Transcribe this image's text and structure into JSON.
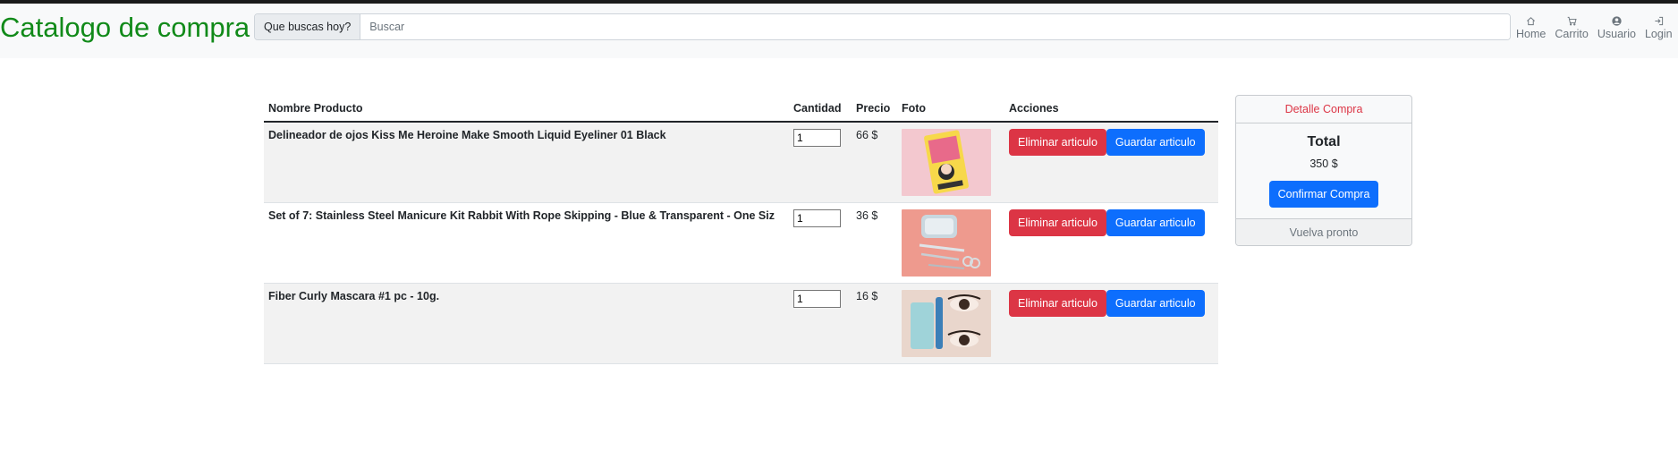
{
  "brand": "Catalogo de compra",
  "search": {
    "label": "Que buscas hoy?",
    "placeholder": "Buscar",
    "value": ""
  },
  "nav": [
    {
      "label": "Home",
      "icon": "home-icon"
    },
    {
      "label": "Carrito",
      "icon": "cart-icon"
    },
    {
      "label": "Usuario",
      "icon": "user-icon"
    },
    {
      "label": "Login",
      "icon": "login-icon"
    }
  ],
  "table": {
    "headers": [
      "Nombre Producto",
      "Cantidad",
      "Precio",
      "Foto",
      "Acciones"
    ],
    "rows": [
      {
        "name": "Delineador de ojos Kiss Me Heroine Make Smooth Liquid Eyeliner 01 Black",
        "qty": "1",
        "price": "66 $",
        "photo": "eyeliner-photo",
        "delete_label": "Eliminar articulo",
        "save_label": "Guardar articulo"
      },
      {
        "name": "Set of 7: Stainless Steel Manicure Kit Rabbit With Rope Skipping - Blue & Transparent - One Siz",
        "qty": "1",
        "price": "36 $",
        "photo": "manicure-kit-photo",
        "delete_label": "Eliminar articulo",
        "save_label": "Guardar articulo"
      },
      {
        "name": "Fiber Curly Mascara #1 pc - 10g.",
        "qty": "1",
        "price": "16 $",
        "photo": "mascara-photo",
        "delete_label": "Eliminar articulo",
        "save_label": "Guardar articulo"
      }
    ]
  },
  "summary": {
    "header": "Detalle Compra",
    "title": "Total",
    "total": "350 $",
    "confirm_label": "Confirmar Compra",
    "footer": "Vuelva pronto"
  },
  "colors": {
    "brand": "#118a19",
    "danger": "#dc3545",
    "primary": "#0d6efd"
  }
}
